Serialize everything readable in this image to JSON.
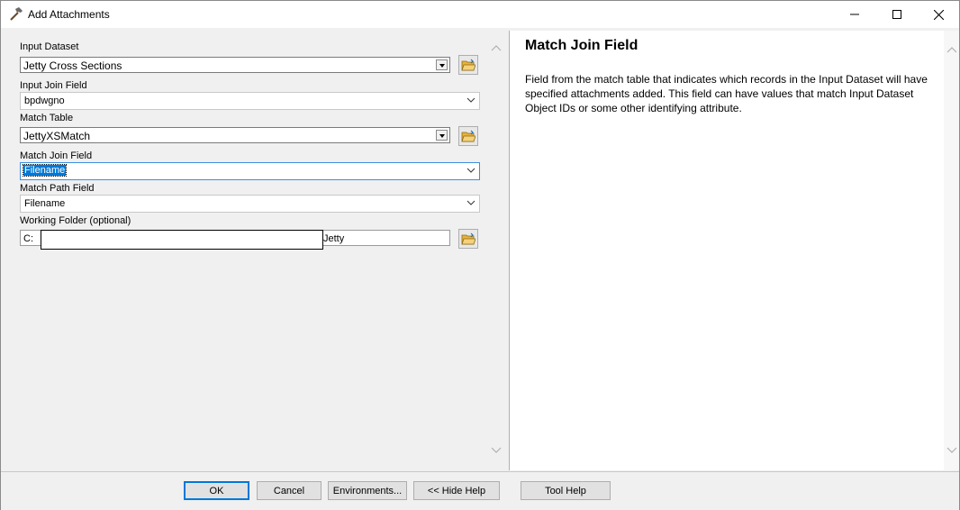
{
  "window": {
    "title": "Add Attachments",
    "icon": "hammer-icon",
    "controls": [
      "minimize-icon",
      "maximize-icon",
      "close-icon"
    ]
  },
  "form": {
    "input_dataset": {
      "label": "Input Dataset",
      "value": "Jetty Cross Sections"
    },
    "input_join_field": {
      "label": "Input Join Field",
      "value": "bpdwgno"
    },
    "match_table": {
      "label": "Match Table",
      "value": "JettyXSMatch"
    },
    "match_join_field": {
      "label": "Match Join Field",
      "value": "Filename"
    },
    "match_path_field": {
      "label": "Match Path Field",
      "value": "Filename"
    },
    "working_folder": {
      "label": "Working Folder (optional)",
      "value_start": "C:",
      "value_end": "Jetty"
    }
  },
  "help": {
    "title": "Match Join Field",
    "body": "Field from the match table that indicates which records in the Input Dataset will have specified attachments added. This field can have values that match Input Dataset Object IDs or some other identifying attribute."
  },
  "buttons": {
    "ok": "OK",
    "cancel": "Cancel",
    "environments": "Environments...",
    "hide_help": "<< Hide Help",
    "tool_help": "Tool Help"
  },
  "colors": {
    "accent": "#0078d7",
    "folder": "#e8b23a"
  }
}
